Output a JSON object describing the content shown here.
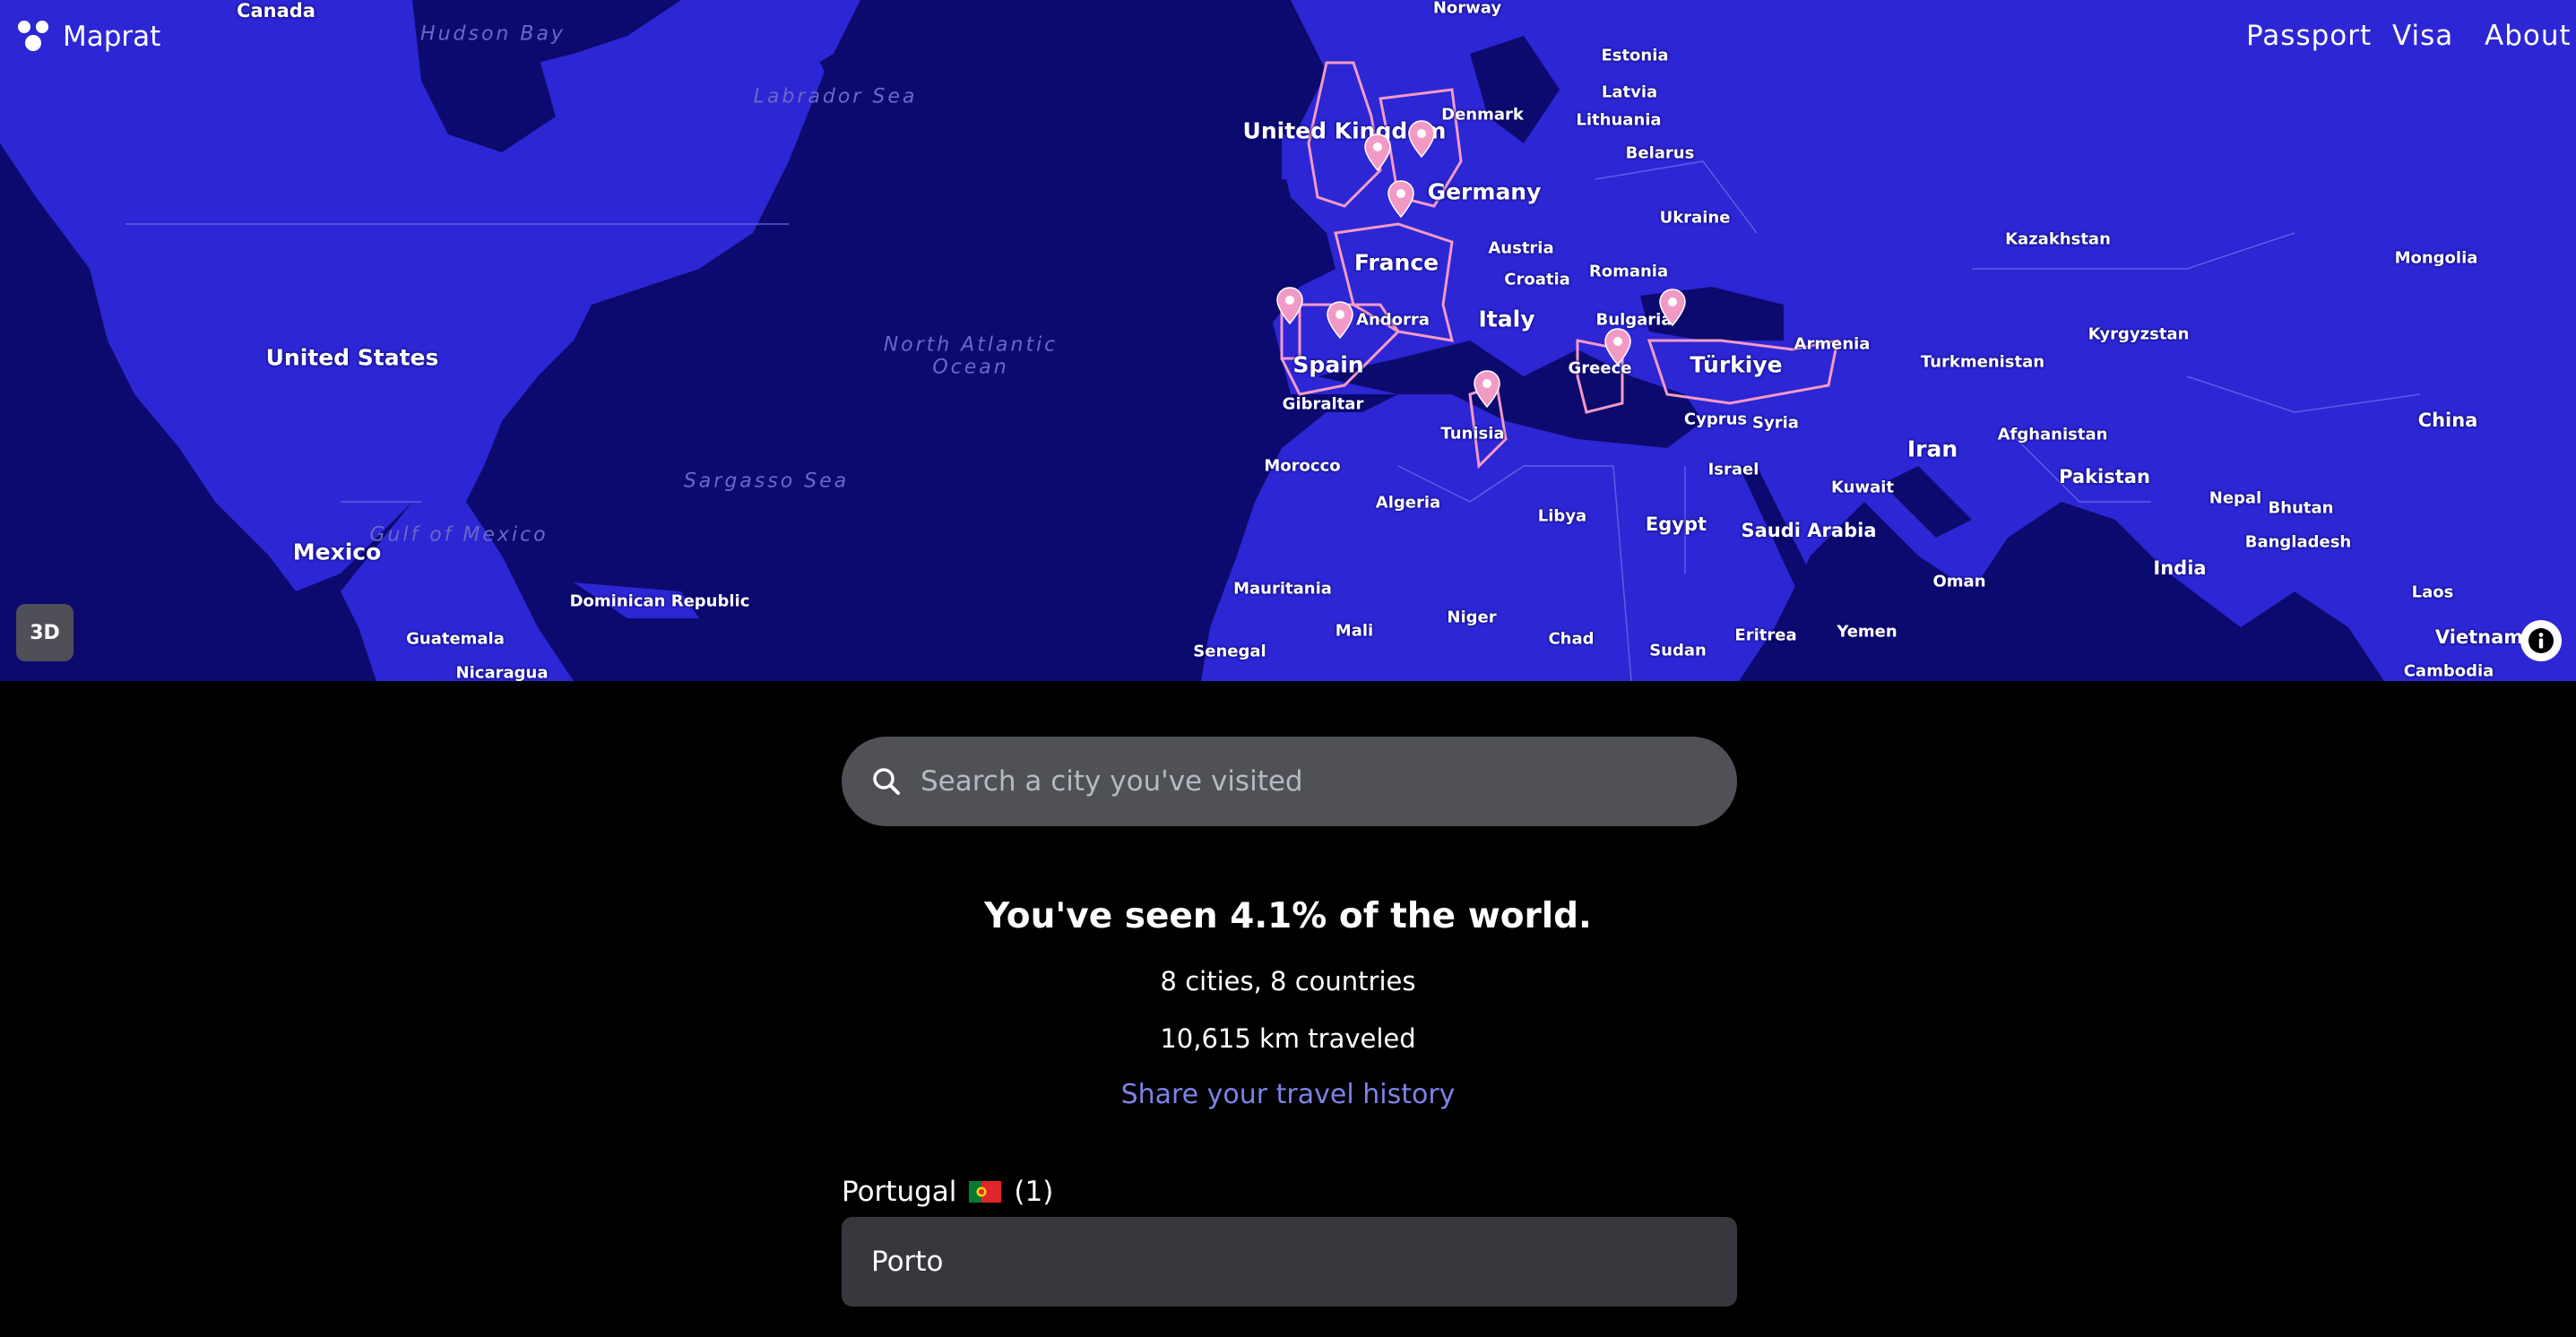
{
  "header": {
    "brand": "Maprat",
    "nav": [
      "Passport",
      "Visa",
      "About"
    ]
  },
  "map": {
    "toggle_3d": "3D",
    "labels": {
      "canada": "Canada",
      "hudson_bay": "Hudson Bay",
      "labrador_sea": "Labrador Sea",
      "united_states": "United States",
      "north_atlantic": "North Atlantic Ocean",
      "sargasso": "Sargasso Sea",
      "gulf_mexico": "Gulf of Mexico",
      "mexico": "Mexico",
      "dominican": "Dominican Republic",
      "guatemala": "Guatemala",
      "nicaragua": "Nicaragua",
      "norway": "Norway",
      "estonia": "Estonia",
      "latvia": "Latvia",
      "lithuania": "Lithuania",
      "denmark": "Denmark",
      "belarus": "Belarus",
      "uk": "United Kingdom",
      "germany": "Germany",
      "ukraine": "Ukraine",
      "austria": "Austria",
      "france": "France",
      "croatia": "Croatia",
      "romania": "Romania",
      "kazakhstan": "Kazakhstan",
      "mongolia": "Mongolia",
      "andorra": "Andorra",
      "italy": "Italy",
      "bulgaria": "Bulgaria",
      "spain": "Spain",
      "greece": "Greece",
      "turkiye": "Türkiye",
      "armenia": "Armenia",
      "turkmenistan": "Turkmenistan",
      "kyrgyzstan": "Kyrgyzstan",
      "gibraltar": "Gibraltar",
      "tunisia": "Tunisia",
      "cyprus": "Cyprus",
      "syria": "Syria",
      "iran": "Iran",
      "afghanistan": "Afghanistan",
      "china": "China",
      "morocco": "Morocco",
      "israel": "Israel",
      "kuwait": "Kuwait",
      "pakistan": "Pakistan",
      "algeria": "Algeria",
      "libya": "Libya",
      "egypt": "Egypt",
      "saudi": "Saudi Arabia",
      "nepal": "Nepal",
      "bhutan": "Bhutan",
      "bangladesh": "Bangladesh",
      "india": "India",
      "oman": "Oman",
      "mauritania": "Mauritania",
      "mali": "Mali",
      "niger": "Niger",
      "laos": "Laos",
      "chad": "Chad",
      "eritrea": "Eritrea",
      "yemen": "Yemen",
      "vietnam": "Vietnam",
      "senegal": "Senegal",
      "sudan": "Sudan",
      "cambodia": "Cambodia"
    }
  },
  "search": {
    "placeholder": "Search a city you've visited"
  },
  "stats": {
    "headline": "You've seen 4.1% of the world.",
    "cities_countries": "8 cities, 8 countries",
    "distance": "10,615 km traveled",
    "share_link": "Share your travel history"
  },
  "visited": [
    {
      "country": "Portugal",
      "count": "(1)",
      "cities": [
        "Porto"
      ]
    }
  ],
  "colors": {
    "ocean": "#0c0a6e",
    "land": "#2c26d4",
    "visited_outline": "#f29ac6",
    "pin": "#f29ac6",
    "link": "#7d83e6"
  }
}
